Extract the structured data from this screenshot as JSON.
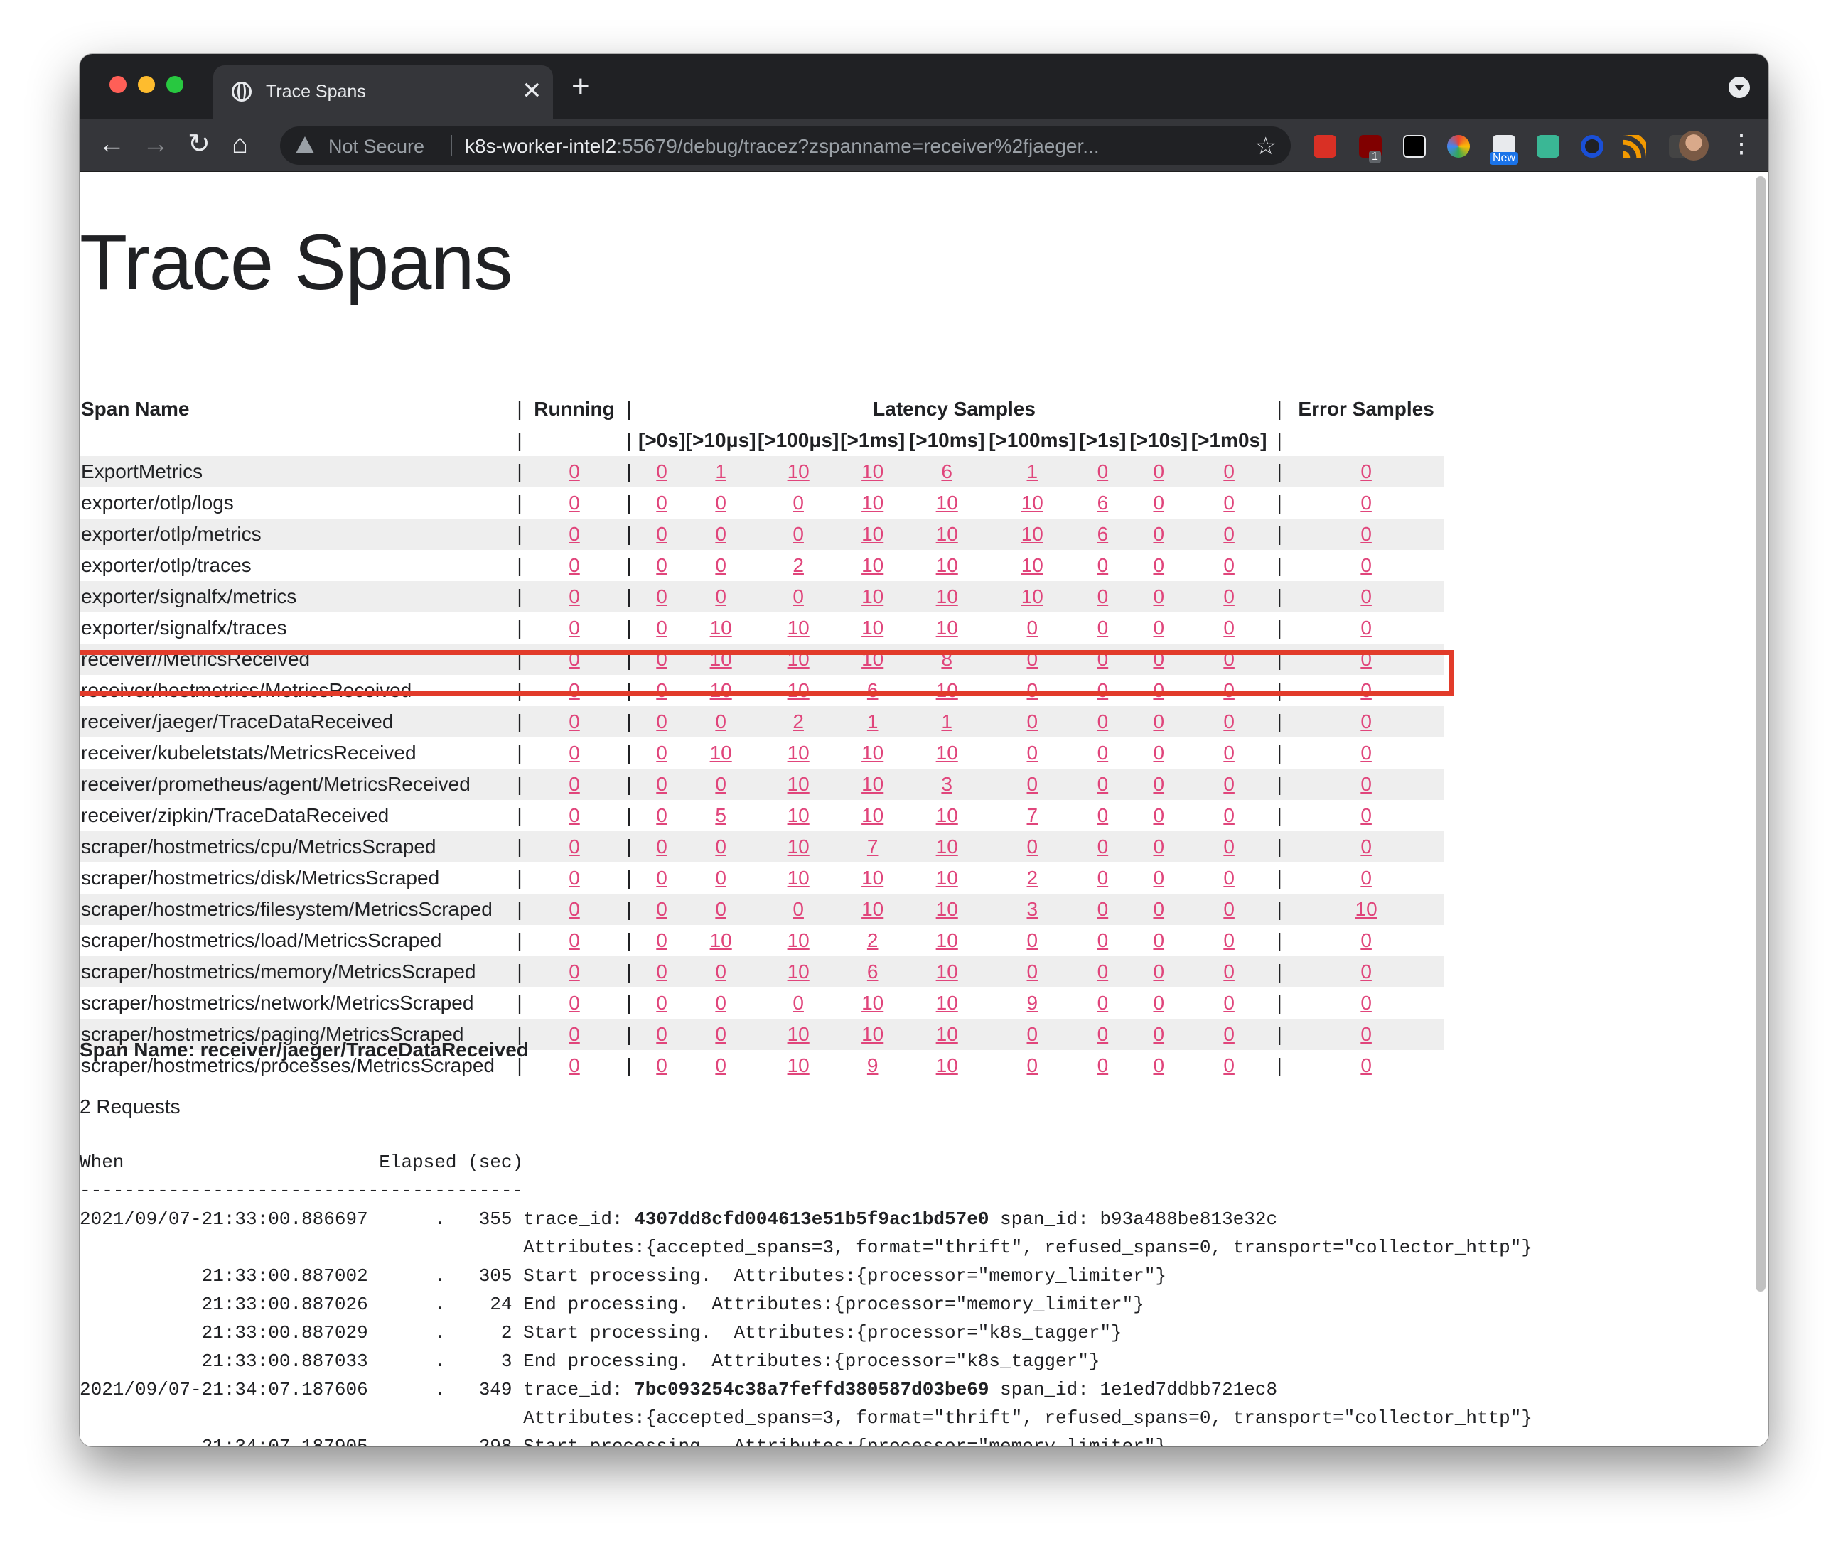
{
  "browser": {
    "tab_title": "Trace Spans",
    "tab_close": "✕",
    "new_tab": "+",
    "security_label": "Not Secure",
    "url_host": "k8s-worker-intel2",
    "url_rest": ":55679/debug/tracez?zspanname=receiver%2fjaeger...",
    "ext_badge_count": "1",
    "ext_badge_new": "New",
    "icons": {
      "back": "←",
      "forward": "→",
      "reload": "↻",
      "home": "⌂",
      "star": "☆",
      "menu": "⋮",
      "extensions": "✚"
    }
  },
  "page": {
    "title": "Trace Spans",
    "headers": {
      "span_name": "Span Name",
      "running": "Running",
      "latency": "Latency Samples",
      "error": "Error Samples",
      "separator": "|",
      "buckets": [
        "[>0s]",
        "[>10μs]",
        "[>100μs]",
        "[>1ms]",
        "[>10ms]",
        "[>100ms]",
        "[>1s]",
        "[>10s]",
        "[>1m0s]"
      ]
    },
    "rows": [
      {
        "name": "ExportMetrics",
        "running": "0",
        "lat": [
          "0",
          "1",
          "10",
          "10",
          "6",
          "1",
          "0",
          "0",
          "0"
        ],
        "err": "0"
      },
      {
        "name": "exporter/otlp/logs",
        "running": "0",
        "lat": [
          "0",
          "0",
          "0",
          "10",
          "10",
          "10",
          "6",
          "0",
          "0"
        ],
        "err": "0"
      },
      {
        "name": "exporter/otlp/metrics",
        "running": "0",
        "lat": [
          "0",
          "0",
          "0",
          "10",
          "10",
          "10",
          "6",
          "0",
          "0"
        ],
        "err": "0"
      },
      {
        "name": "exporter/otlp/traces",
        "running": "0",
        "lat": [
          "0",
          "0",
          "2",
          "10",
          "10",
          "10",
          "0",
          "0",
          "0"
        ],
        "err": "0"
      },
      {
        "name": "exporter/signalfx/metrics",
        "running": "0",
        "lat": [
          "0",
          "0",
          "0",
          "10",
          "10",
          "10",
          "0",
          "0",
          "0"
        ],
        "err": "0"
      },
      {
        "name": "exporter/signalfx/traces",
        "running": "0",
        "lat": [
          "0",
          "10",
          "10",
          "10",
          "10",
          "0",
          "0",
          "0",
          "0"
        ],
        "err": "0"
      },
      {
        "name": "receiver//MetricsReceived",
        "running": "0",
        "lat": [
          "0",
          "10",
          "10",
          "10",
          "8",
          "0",
          "0",
          "0",
          "0"
        ],
        "err": "0"
      },
      {
        "name": "receiver/hostmetrics/MetricsReceived",
        "running": "0",
        "lat": [
          "0",
          "10",
          "10",
          "6",
          "10",
          "0",
          "0",
          "0",
          "0"
        ],
        "err": "0"
      },
      {
        "name": "receiver/jaeger/TraceDataReceived",
        "running": "0",
        "lat": [
          "0",
          "0",
          "2",
          "1",
          "1",
          "0",
          "0",
          "0",
          "0"
        ],
        "err": "0"
      },
      {
        "name": "receiver/kubeletstats/MetricsReceived",
        "running": "0",
        "lat": [
          "0",
          "10",
          "10",
          "10",
          "10",
          "0",
          "0",
          "0",
          "0"
        ],
        "err": "0"
      },
      {
        "name": "receiver/prometheus/agent/MetricsReceived",
        "running": "0",
        "lat": [
          "0",
          "0",
          "10",
          "10",
          "3",
          "0",
          "0",
          "0",
          "0"
        ],
        "err": "0"
      },
      {
        "name": "receiver/zipkin/TraceDataReceived",
        "running": "0",
        "lat": [
          "0",
          "5",
          "10",
          "10",
          "10",
          "7",
          "0",
          "0",
          "0"
        ],
        "err": "0"
      },
      {
        "name": "scraper/hostmetrics/cpu/MetricsScraped",
        "running": "0",
        "lat": [
          "0",
          "0",
          "10",
          "7",
          "10",
          "0",
          "0",
          "0",
          "0"
        ],
        "err": "0"
      },
      {
        "name": "scraper/hostmetrics/disk/MetricsScraped",
        "running": "0",
        "lat": [
          "0",
          "0",
          "10",
          "10",
          "10",
          "2",
          "0",
          "0",
          "0"
        ],
        "err": "0"
      },
      {
        "name": "scraper/hostmetrics/filesystem/MetricsScraped",
        "running": "0",
        "lat": [
          "0",
          "0",
          "0",
          "10",
          "10",
          "3",
          "0",
          "0",
          "0"
        ],
        "err": "10"
      },
      {
        "name": "scraper/hostmetrics/load/MetricsScraped",
        "running": "0",
        "lat": [
          "0",
          "10",
          "10",
          "2",
          "10",
          "0",
          "0",
          "0",
          "0"
        ],
        "err": "0"
      },
      {
        "name": "scraper/hostmetrics/memory/MetricsScraped",
        "running": "0",
        "lat": [
          "0",
          "0",
          "10",
          "6",
          "10",
          "0",
          "0",
          "0",
          "0"
        ],
        "err": "0"
      },
      {
        "name": "scraper/hostmetrics/network/MetricsScraped",
        "running": "0",
        "lat": [
          "0",
          "0",
          "0",
          "10",
          "10",
          "9",
          "0",
          "0",
          "0"
        ],
        "err": "0"
      },
      {
        "name": "scraper/hostmetrics/paging/MetricsScraped",
        "running": "0",
        "lat": [
          "0",
          "0",
          "10",
          "10",
          "10",
          "0",
          "0",
          "0",
          "0"
        ],
        "err": "0"
      },
      {
        "name": "scraper/hostmetrics/processes/MetricsScraped",
        "running": "0",
        "lat": [
          "0",
          "0",
          "10",
          "9",
          "10",
          "0",
          "0",
          "0",
          "0"
        ],
        "err": "0"
      }
    ],
    "highlighted_row": "receiver/jaeger/TraceDataReceived",
    "detail": {
      "span_name_label": "Span Name: receiver/jaeger/TraceDataReceived",
      "requests": "2 Requests",
      "header": "When                       Elapsed (sec)",
      "rule": "----------------------------------------",
      "lines": [
        {
          "pre": "2021/09/07-21:33:00.886697      .   355 trace_id: ",
          "bold": "4307dd8cfd004613e51b5f9ac1bd57e0",
          "post": " span_id: b93a488be813e32c"
        },
        {
          "pre": "                                        Attributes:{accepted_spans=3, format=\"thrift\", refused_spans=0, transport=\"collector_http\"}",
          "bold": "",
          "post": ""
        },
        {
          "pre": "           21:33:00.887002      .   305 Start processing.  Attributes:{processor=\"memory_limiter\"}",
          "bold": "",
          "post": ""
        },
        {
          "pre": "           21:33:00.887026      .    24 End processing.  Attributes:{processor=\"memory_limiter\"}",
          "bold": "",
          "post": ""
        },
        {
          "pre": "           21:33:00.887029      .     2 Start processing.  Attributes:{processor=\"k8s_tagger\"}",
          "bold": "",
          "post": ""
        },
        {
          "pre": "           21:33:00.887033      .     3 End processing.  Attributes:{processor=\"k8s_tagger\"}",
          "bold": "",
          "post": ""
        },
        {
          "pre": "2021/09/07-21:34:07.187606      .   349 trace_id: ",
          "bold": "7bc093254c38a7feffd380587d03be69",
          "post": " span_id: 1e1ed7ddbb721ec8"
        },
        {
          "pre": "                                        Attributes:{accepted_spans=3, format=\"thrift\", refused_spans=0, transport=\"collector_http\"}",
          "bold": "",
          "post": ""
        },
        {
          "pre": "           21:34:07.187905      .   298 Start processing.  Attributes:{processor=\"memory_limiter\"}",
          "bold": "",
          "post": ""
        }
      ]
    }
  },
  "colors": {
    "link": "#e0457b",
    "highlight_box": "#e23b2a",
    "row_shade": "#eeeeee",
    "chrome_dark": "#202124",
    "chrome_toolbar": "#35363a"
  }
}
